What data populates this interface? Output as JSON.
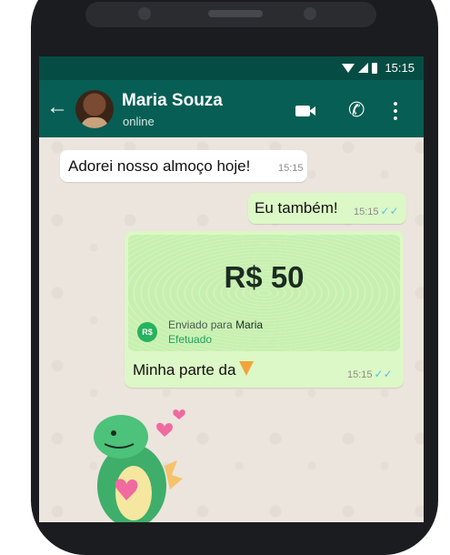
{
  "status_bar": {
    "time": "15:15"
  },
  "app_bar": {
    "back_icon": "arrow-left-icon",
    "contact_name": "Maria Souza",
    "contact_status": "online",
    "actions": [
      "video-call-icon",
      "phone-icon",
      "more-vert-icon"
    ]
  },
  "messages": [
    {
      "direction": "incoming",
      "text": "Adorei nosso almoço hoje!",
      "time": "15:15"
    },
    {
      "direction": "outgoing",
      "text": "Eu também!",
      "time": "15:15",
      "status": "read"
    }
  ],
  "payment": {
    "amount": "R$ 50",
    "badge": "R$",
    "sent_prefix": "Enviado para",
    "recipient": "Maria",
    "status": "Efetuado",
    "note": "Minha parte da",
    "note_icon": "pizza-icon",
    "time": "15:15"
  },
  "sticker": {
    "icon": "dinosaur-heart-sticker"
  },
  "colors": {
    "header": "#075e54",
    "statusbar": "#054d44",
    "outgoing_bubble": "#dcf8c6",
    "chat_bg": "#ece5dd",
    "read_ticks": "#4fc3f7",
    "pay_green": "#25b35c"
  }
}
